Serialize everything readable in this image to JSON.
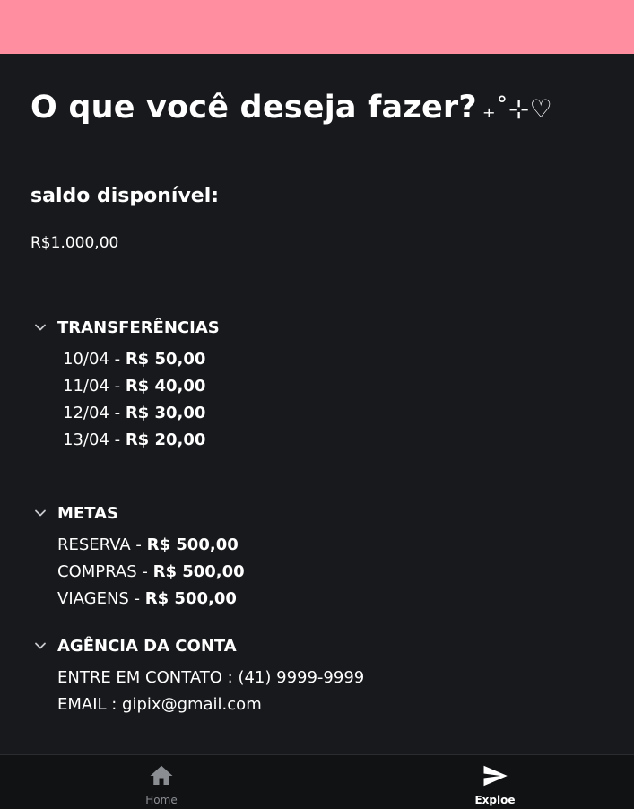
{
  "header": {
    "title": "O que você deseja fazer?",
    "title_decoration": "₊˚⊹♡"
  },
  "balance": {
    "label": "saldo disponível:",
    "value": "R$1.000,00"
  },
  "sections": {
    "transfers": {
      "title": "TRANSFERÊNCIAS",
      "items": [
        {
          "date": "10/04 - ",
          "amount": "R$ 50,00"
        },
        {
          "date": "11/04 - ",
          "amount": "R$ 40,00"
        },
        {
          "date": "12/04 - ",
          "amount": "R$ 30,00"
        },
        {
          "date": "13/04 - ",
          "amount": "R$ 20,00"
        }
      ]
    },
    "goals": {
      "title": "METAS",
      "items": [
        {
          "name": "RESERVA - ",
          "amount": "R$ 500,00"
        },
        {
          "name": "COMPRAS - ",
          "amount": "R$ 500,00"
        },
        {
          "name": "VIAGENS - ",
          "amount": "R$ 500,00"
        }
      ]
    },
    "agency": {
      "title": "AGÊNCIA DA CONTA",
      "items": [
        "ENTRE EM CONTATO : (41) 9999-9999",
        "EMAIL : gipix@gmail.com"
      ]
    }
  },
  "bottom_nav": {
    "home_label": "Home",
    "explore_label": "Exploe",
    "home_icon": "home-icon",
    "explore_icon": "send-icon"
  },
  "colors": {
    "accent": "#ff8fa0",
    "background": "#17191c",
    "nav_background": "#111214"
  }
}
